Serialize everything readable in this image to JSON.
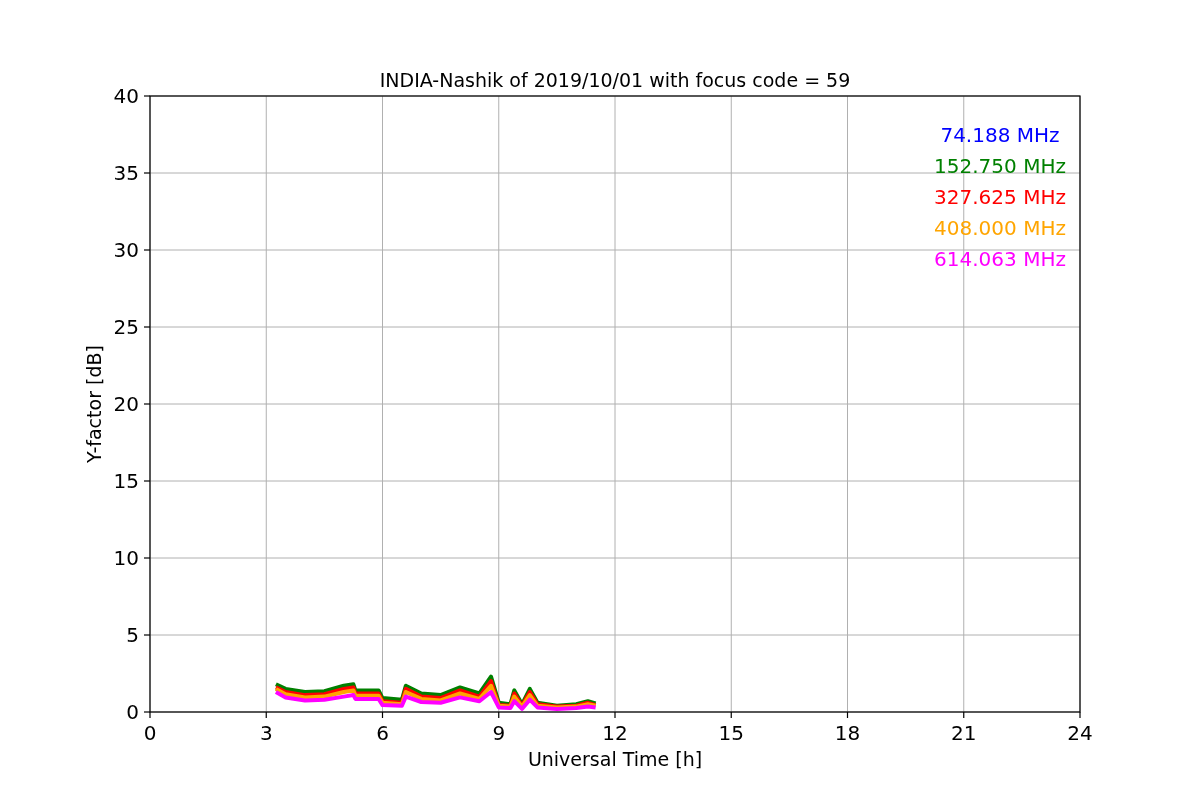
{
  "chart_data": {
    "type": "line",
    "title": "INDIA-Nashik of 2019/10/01 with focus code = 59",
    "xlabel": "Universal Time [h]",
    "ylabel": "Y-factor [dB]",
    "x": [
      3.25,
      3.5,
      4,
      4.5,
      5,
      5.25,
      5.3,
      5.9,
      6,
      6.5,
      6.6,
      7,
      7.5,
      8,
      8.5,
      8.8,
      9,
      9.3,
      9.4,
      9.6,
      9.8,
      10,
      10.5,
      11,
      11.3,
      11.5
    ],
    "series": [
      {
        "name": "74.188 MHz",
        "color": "#0000ff",
        "values": [
          null,
          null,
          null,
          null,
          null,
          null,
          null,
          null,
          null,
          null,
          null,
          null,
          null,
          null,
          null,
          null,
          null,
          null,
          null,
          null,
          null,
          null,
          null,
          null,
          null,
          null
        ]
      },
      {
        "name": "152.750 MHz",
        "color": "#008000",
        "values": [
          1.8,
          1.5,
          1.3,
          1.35,
          1.7,
          1.8,
          1.4,
          1.4,
          0.9,
          0.8,
          1.7,
          1.2,
          1.1,
          1.6,
          1.2,
          2.3,
          0.6,
          0.5,
          1.4,
          0.5,
          1.5,
          0.6,
          0.4,
          0.5,
          0.7,
          0.55
        ]
      },
      {
        "name": "327.625 MHz",
        "color": "#ff0000",
        "values": [
          1.6,
          1.3,
          1.1,
          1.15,
          1.5,
          1.6,
          1.2,
          1.2,
          0.7,
          0.6,
          1.5,
          1.0,
          0.9,
          1.4,
          1.0,
          2.0,
          0.45,
          0.4,
          1.2,
          0.4,
          1.3,
          0.5,
          0.35,
          0.4,
          0.6,
          0.45
        ]
      },
      {
        "name": "408.000 MHz",
        "color": "#ffa500",
        "values": [
          1.5,
          1.15,
          0.95,
          1.0,
          1.3,
          1.4,
          1.05,
          1.05,
          0.6,
          0.5,
          1.3,
          0.85,
          0.75,
          1.2,
          0.85,
          1.7,
          0.4,
          0.35,
          1.0,
          0.35,
          1.1,
          0.4,
          0.3,
          0.35,
          0.5,
          0.4
        ]
      },
      {
        "name": "614.063 MHz",
        "color": "#ff00ff",
        "values": [
          1.3,
          0.95,
          0.75,
          0.8,
          1.0,
          1.1,
          0.85,
          0.85,
          0.45,
          0.4,
          1.0,
          0.65,
          0.6,
          0.95,
          0.7,
          1.3,
          0.3,
          0.25,
          0.7,
          0.2,
          0.8,
          0.3,
          0.2,
          0.25,
          0.35,
          0.3
        ]
      }
    ],
    "grid": true,
    "xlim": [
      0,
      24
    ],
    "ylim": [
      0,
      40
    ],
    "xticks": [
      0,
      3,
      6,
      9,
      12,
      15,
      18,
      21,
      24
    ],
    "yticks": [
      0,
      5,
      10,
      15,
      20,
      25,
      30,
      35,
      40
    ]
  }
}
